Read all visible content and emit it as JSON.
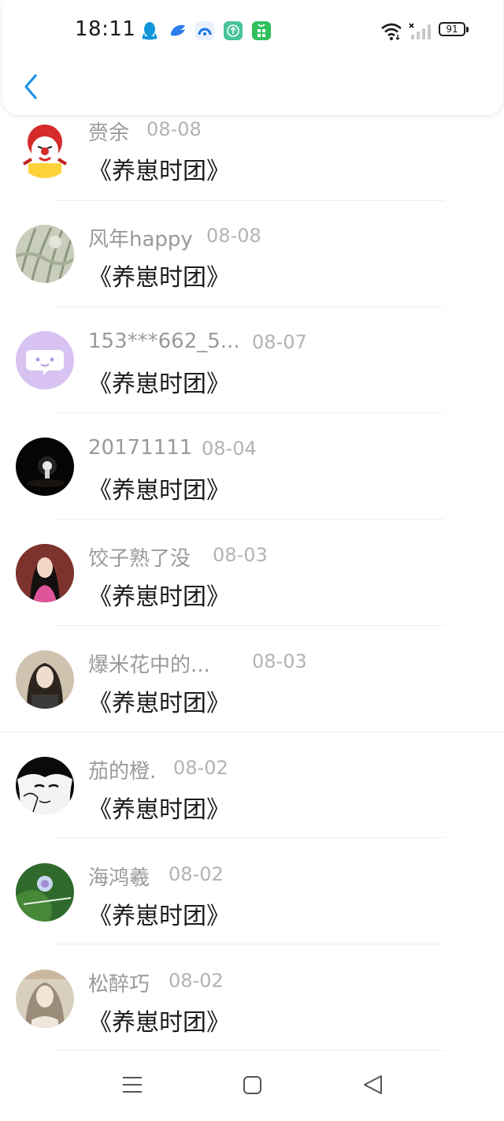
{
  "status_bar": {
    "time": "18:11",
    "battery": "91",
    "notification_icons": [
      "qq-icon",
      "bird-app-icon",
      "browser-app-icon",
      "update-app-icon",
      "store-app-icon"
    ]
  },
  "header": {
    "back_icon": "chevron-left-icon"
  },
  "colors": {
    "accent": "#1e90e6",
    "name_gray": "#9a9a9a",
    "date_gray": "#b3b3b3",
    "message": "#1c1c1c"
  },
  "comments": [
    {
      "name": "赍余",
      "date": "08-08",
      "message": "《养崽时团》"
    },
    {
      "name": "风年happy",
      "date": "08-08",
      "message": "《养崽时团》"
    },
    {
      "name": "153***662_5...",
      "date": "08-07",
      "message": "《养崽时团》"
    },
    {
      "name": "20171111",
      "date": "08-04",
      "message": "《养崽时团》"
    },
    {
      "name": "饺子熟了没",
      "date": "08-03",
      "message": "《养崽时团》"
    },
    {
      "name": "爆米花中的...",
      "date": "08-03",
      "message": "《养崽时团》"
    },
    {
      "name": "茄的橙.",
      "date": "08-02",
      "message": "《养崽时团》"
    },
    {
      "name": "海鸿羲",
      "date": "08-02",
      "message": "《养崽时团》"
    },
    {
      "name": "松醉巧",
      "date": "08-02",
      "message": "《养崽时团》"
    }
  ],
  "navbar": {
    "icons": [
      "menu-icon",
      "home-square-icon",
      "back-triangle-icon"
    ]
  }
}
